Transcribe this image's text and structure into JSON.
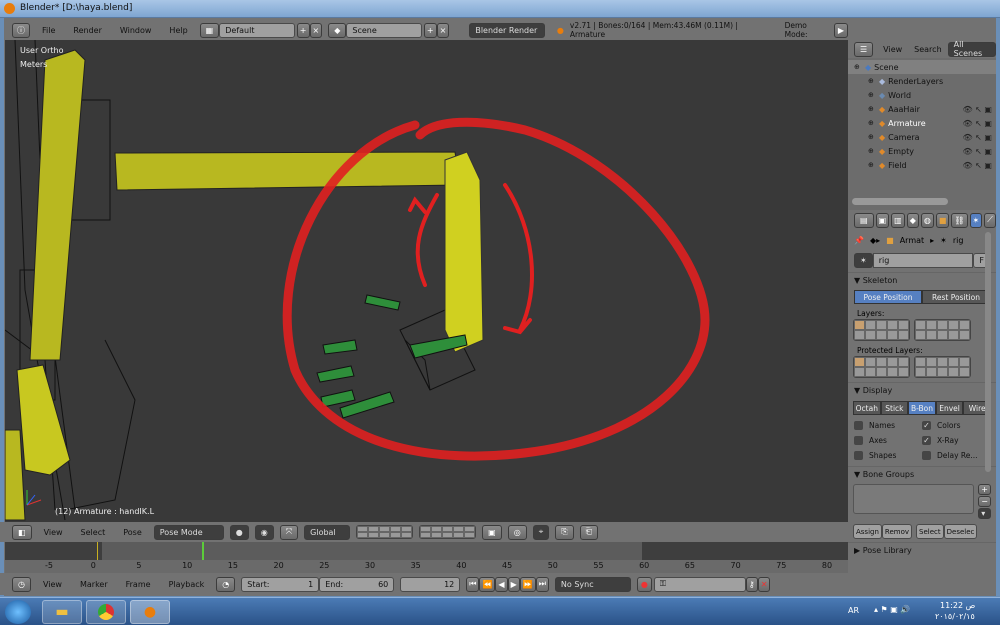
{
  "window": {
    "title": "Blender* [D:\\haya.blend]"
  },
  "info_header": {
    "menus": [
      "File",
      "Render",
      "Window",
      "Help"
    ],
    "screen_layout": "Default",
    "scene": "Scene",
    "render_engine": "Blender Render",
    "stats": "v2.71 | Bones:0/164 | Mem:43.46M (0.11M) | Armature",
    "demo_mode": "Demo Mode:"
  },
  "viewport": {
    "view_label": "User Ortho",
    "units": "Meters",
    "status": "(12) Armature : handIK.L"
  },
  "view3d_header": {
    "menus": [
      "View",
      "Select",
      "Pose"
    ],
    "mode": "Pose Mode",
    "orientation": "Global"
  },
  "timeline": {
    "ticks": [
      "-5",
      "0",
      "5",
      "10",
      "15",
      "20",
      "25",
      "30",
      "35",
      "40",
      "45",
      "50",
      "55",
      "60",
      "65",
      "70",
      "75",
      "80"
    ],
    "current_frame": 12,
    "menus": [
      "View",
      "Marker",
      "Frame",
      "Playback"
    ],
    "start_label": "Start:",
    "start": "1",
    "end_label": "End:",
    "end": "60",
    "frame": "12",
    "sync": "No Sync"
  },
  "outliner": {
    "menus": [
      "View",
      "Search"
    ],
    "filter": "All Scenes",
    "items": [
      {
        "label": "Scene",
        "indent": 0,
        "icon": "scene-icon",
        "color": "#4a7ac0"
      },
      {
        "label": "RenderLayers",
        "indent": 1,
        "icon": "renderlayers-icon",
        "color": "#aabbdd"
      },
      {
        "label": "World",
        "indent": 1,
        "icon": "world-icon",
        "color": "#6a8ab0"
      },
      {
        "label": "AaaHair",
        "indent": 1,
        "icon": "mesh-icon",
        "color": "#e08a2a"
      },
      {
        "label": "Armature",
        "indent": 1,
        "icon": "armature-icon",
        "color": "#e08a2a",
        "active": true
      },
      {
        "label": "Camera",
        "indent": 1,
        "icon": "camera-icon",
        "color": "#e08a2a"
      },
      {
        "label": "Empty",
        "indent": 1,
        "icon": "empty-icon",
        "color": "#e08a2a"
      },
      {
        "label": "Field",
        "indent": 1,
        "icon": "field-icon",
        "color": "#e08a2a"
      }
    ]
  },
  "properties": {
    "breadcrumb_object": "Armat",
    "breadcrumb_data": "rig",
    "datablock": "rig",
    "fake_user": "F",
    "skeleton": {
      "title": "Skeleton",
      "pose_position": "Pose Position",
      "rest_position": "Rest Position",
      "layers": "Layers:",
      "protected_layers": "Protected Layers:"
    },
    "display": {
      "title": "Display",
      "types": [
        "Octah",
        "Stick",
        "B-Bon",
        "Envel",
        "Wire"
      ],
      "active_type": "B-Bon",
      "options": [
        {
          "label": "Names",
          "checked": false
        },
        {
          "label": "Colors",
          "checked": true
        },
        {
          "label": "Axes",
          "checked": false
        },
        {
          "label": "X-Ray",
          "checked": true
        },
        {
          "label": "Shapes",
          "checked": false
        },
        {
          "label": "Delay Re...",
          "checked": false
        }
      ]
    },
    "bone_groups": {
      "title": "Bone Groups",
      "assign": "Assign",
      "remove": "Remov",
      "select": "Select",
      "deselect": "Deselec"
    },
    "pose_library": "Pose Library"
  },
  "taskbar": {
    "lang": "AR",
    "time": "11:22 ص",
    "date": "٢٠١٥/٠٢/١٥"
  },
  "colors": {
    "accent": "#5680c2",
    "annotation": "#e02020",
    "bone_yellow": "#c8c820",
    "bone_green": "#3a9a3a"
  }
}
